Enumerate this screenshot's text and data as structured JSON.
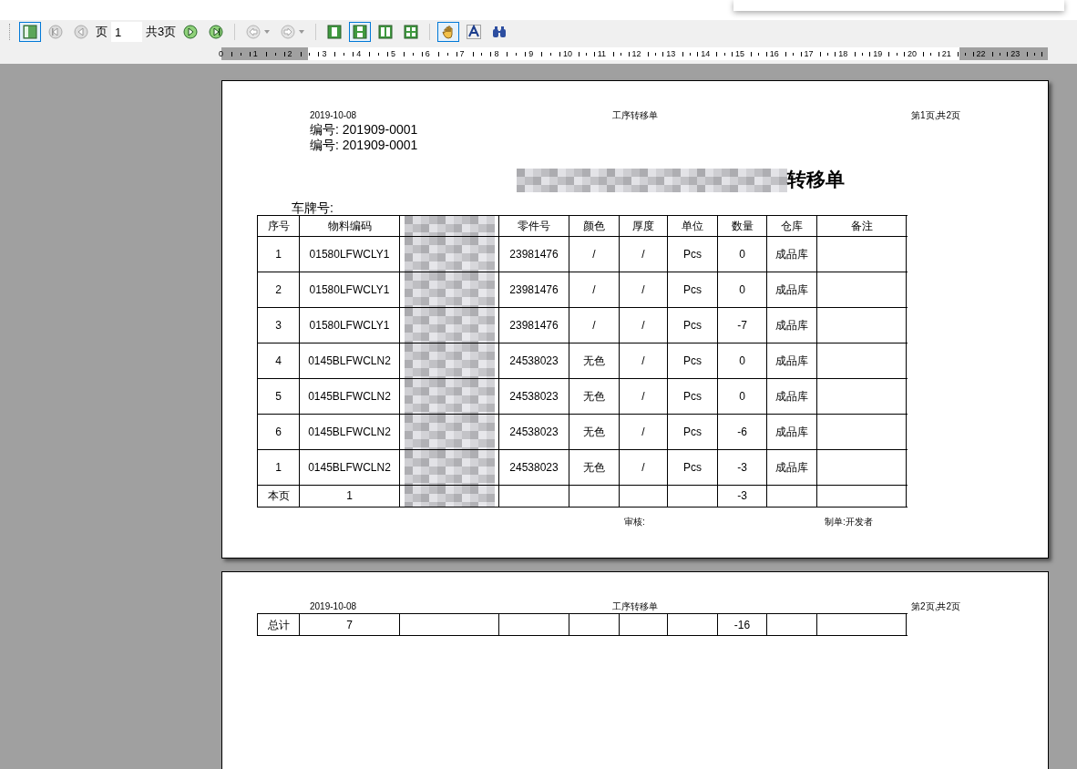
{
  "toolbar": {
    "buttons": [
      {
        "kind": "sidebar",
        "selected": true
      },
      {
        "kind": "first",
        "selected": false,
        "disabled": true
      },
      {
        "kind": "prev",
        "selected": false,
        "disabled": true
      },
      {
        "kind": "page_label",
        "text": "页"
      },
      {
        "kind": "page_input",
        "value": "1"
      },
      {
        "kind": "page_count",
        "text": "共3页"
      },
      {
        "kind": "next",
        "selected": false,
        "disabled": false
      },
      {
        "kind": "last",
        "selected": false,
        "disabled": false
      },
      {
        "kind": "sep"
      },
      {
        "kind": "back",
        "selected": false,
        "disabled": true
      },
      {
        "kind": "forward",
        "selected": false,
        "disabled": true
      },
      {
        "kind": "sep"
      },
      {
        "kind": "single",
        "selected": false
      },
      {
        "kind": "continuous",
        "selected": true
      },
      {
        "kind": "facing",
        "selected": false
      },
      {
        "kind": "multi",
        "selected": false
      },
      {
        "kind": "sep"
      },
      {
        "kind": "hand",
        "selected": true
      },
      {
        "kind": "text",
        "selected": false
      },
      {
        "kind": "find",
        "selected": false
      }
    ]
  },
  "ruler": {
    "labels": [
      "0",
      "1",
      "2",
      "3",
      "4",
      "5",
      "6",
      "7",
      "8",
      "9",
      "10",
      "11",
      "12",
      "13",
      "14",
      "15",
      "16",
      "17",
      "18",
      "19",
      "20",
      "21",
      "22",
      "23"
    ]
  },
  "page1": {
    "header": {
      "date": "2019-10-08",
      "center": "工序转移单",
      "page": "第1页,共2页"
    },
    "numbers": [
      "编号: 201909-0001",
      "编号: 201909-0001"
    ],
    "title": "转移单",
    "plate": "车牌号:",
    "table": {
      "columns": {
        "seq": "序号",
        "material_code": "物料编码",
        "part_no": "零件号",
        "color_name": "颜色",
        "thickness": "厚度",
        "unit": "单位",
        "quantity": "数量",
        "warehouse": "仓库",
        "remarks": "备注"
      },
      "rows": [
        {
          "seq": "1",
          "material_code": "01580LFWCLY1",
          "part_no": "23981476",
          "color_name": "/",
          "thickness": "/",
          "unit": "Pcs",
          "quantity": "0",
          "warehouse": "成品库"
        },
        {
          "seq": "2",
          "material_code": "01580LFWCLY1",
          "part_no": "23981476",
          "color_name": "/",
          "thickness": "/",
          "unit": "Pcs",
          "quantity": "0",
          "warehouse": "成品库"
        },
        {
          "seq": "3",
          "material_code": "01580LFWCLY1",
          "part_no": "23981476",
          "color_name": "/",
          "thickness": "/",
          "unit": "Pcs",
          "quantity": "-7",
          "warehouse": "成品库"
        },
        {
          "seq": "4",
          "material_code": "0145BLFWCLN2",
          "part_no": "24538023",
          "color_name": "无色",
          "thickness": "/",
          "unit": "Pcs",
          "quantity": "0",
          "warehouse": "成品库"
        },
        {
          "seq": "5",
          "material_code": "0145BLFWCLN2",
          "part_no": "24538023",
          "color_name": "无色",
          "thickness": "/",
          "unit": "Pcs",
          "quantity": "0",
          "warehouse": "成品库"
        },
        {
          "seq": "6",
          "material_code": "0145BLFWCLN2",
          "part_no": "24538023",
          "color_name": "无色",
          "thickness": "/",
          "unit": "Pcs",
          "quantity": "-6",
          "warehouse": "成品库"
        },
        {
          "seq": "1",
          "material_code": "0145BLFWCLN2",
          "part_no": "24538023",
          "color_name": "无色",
          "thickness": "/",
          "unit": "Pcs",
          "quantity": "-3",
          "warehouse": "成品库"
        }
      ],
      "subtotal": {
        "seq": "本页",
        "material_code": "1",
        "quantity": "-3"
      }
    },
    "footer": [
      "审核:",
      "制单:开发者"
    ]
  },
  "page2": {
    "header": {
      "date": "2019-10-08",
      "center": "工序转移单",
      "page": "第2页,共2页"
    },
    "total": {
      "seq": "总计",
      "material_code": "7",
      "quantity": "-16"
    }
  }
}
